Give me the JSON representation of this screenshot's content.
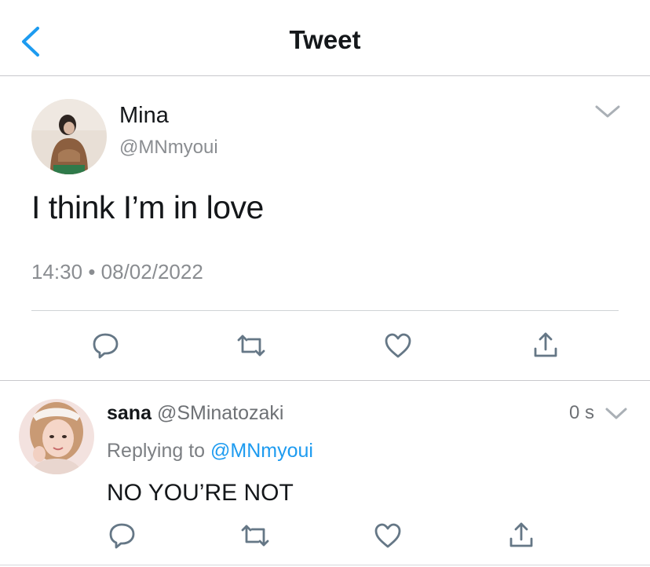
{
  "header": {
    "title": "Tweet",
    "back_icon": "chevron-left-icon",
    "accent_color": "#1d9bf0"
  },
  "tweet": {
    "author_name": "Mina",
    "author_handle": "@MNmyoui",
    "text": "I think I’m in love",
    "time": "14:30",
    "separator": "•",
    "date": "08/02/2022",
    "menu_icon": "chevron-down-icon",
    "actions": [
      "reply-icon",
      "retweet-icon",
      "like-icon",
      "share-icon"
    ]
  },
  "reply": {
    "author_name": "sana",
    "author_handle": "@SMinatozaki",
    "time_ago": "0 s",
    "replying_prefix": "Replying to",
    "replying_to": "@MNmyoui",
    "text": "NO YOU’RE NOT",
    "menu_icon": "chevron-down-icon",
    "actions": [
      "reply-icon",
      "retweet-icon",
      "like-icon",
      "share-icon"
    ]
  }
}
